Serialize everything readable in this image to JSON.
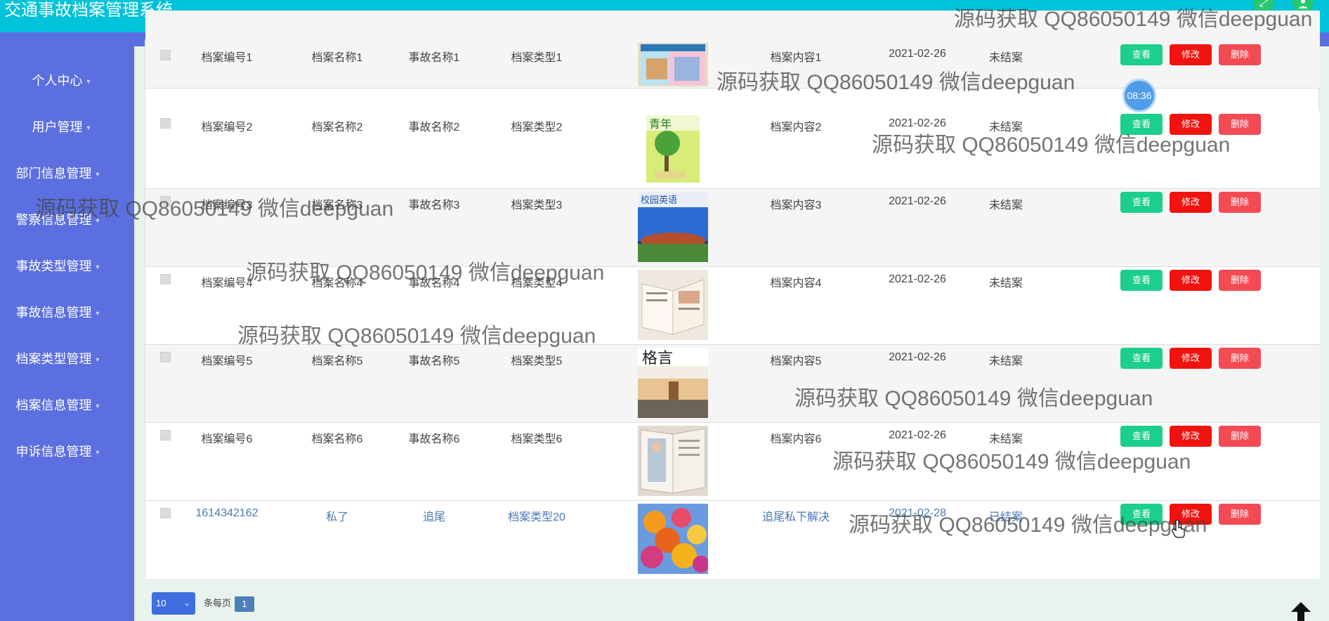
{
  "header": {
    "title": "交通事故档案管理系统"
  },
  "sidebar": {
    "items": [
      {
        "label": "个人中心"
      },
      {
        "label": "用户管理"
      },
      {
        "label": "部门信息管理"
      },
      {
        "label": "警察信息管理"
      },
      {
        "label": "事故类型管理"
      },
      {
        "label": "事故信息管理"
      },
      {
        "label": "档案类型管理"
      },
      {
        "label": "档案信息管理"
      },
      {
        "label": "申诉信息管理"
      }
    ]
  },
  "table": {
    "rows": [
      {
        "no": "档案编号1",
        "name": "档案名称1",
        "accident": "事故名称1",
        "type": "档案类型1",
        "content": "档案内容1",
        "date": "2021-02-26",
        "status": "未结案"
      },
      {
        "no": "档案编号2",
        "name": "档案名称2",
        "accident": "事故名称2",
        "type": "档案类型2",
        "content": "档案内容2",
        "date": "2021-02-26",
        "status": "未结案"
      },
      {
        "no": "档案编号3",
        "name": "档案名称3",
        "accident": "事故名称3",
        "type": "档案类型3",
        "content": "档案内容3",
        "date": "2021-02-26",
        "status": "未结案"
      },
      {
        "no": "档案编号4",
        "name": "档案名称4",
        "accident": "事故名称4",
        "type": "档案类型4",
        "content": "档案内容4",
        "date": "2021-02-26",
        "status": "未结案"
      },
      {
        "no": "档案编号5",
        "name": "档案名称5",
        "accident": "事故名称5",
        "type": "档案类型5",
        "content": "档案内容5",
        "date": "2021-02-26",
        "status": "未结案"
      },
      {
        "no": "档案编号6",
        "name": "档案名称6",
        "accident": "事故名称6",
        "type": "档案类型6",
        "content": "档案内容6",
        "date": "2021-02-26",
        "status": "未结案"
      },
      {
        "no": "1614342162",
        "name": "私了",
        "accident": "追尾",
        "type": "档案类型20",
        "content": "追尾私下解决",
        "date": "2021-02-28",
        "status": "已结案"
      }
    ],
    "actions": {
      "view": "查看",
      "edit": "修改",
      "delete": "删除"
    }
  },
  "pager": {
    "page_size": "10",
    "per_page_label": "条每页",
    "current_page": "1"
  },
  "clock": "08:36",
  "watermark": "源码获取 QQ86050149 微信deepguan"
}
